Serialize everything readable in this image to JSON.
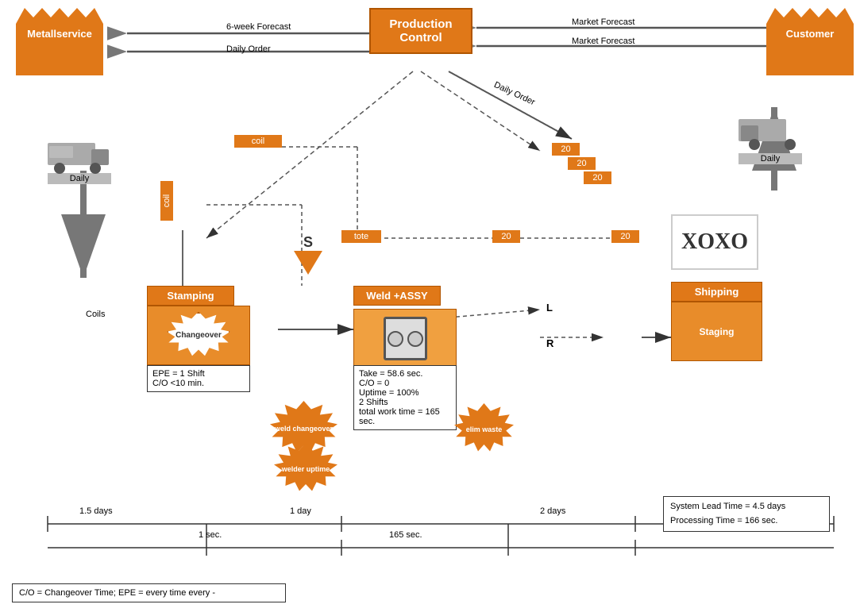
{
  "header": {
    "production_control_label": "Production Control",
    "customer_label": "Customer",
    "metallservice_label": "Metallservice"
  },
  "flows": {
    "week_forecast": "6-week Forecast",
    "daily_order_left": "Daily Order",
    "market_forecast_top": "Market Forecast",
    "market_forecast_bottom": "Market Forecast",
    "daily_order_right": "Daily Order"
  },
  "inventory": {
    "coil_top": "coil",
    "coil_left": "coil",
    "tote": "tote",
    "qty_20_1": "20",
    "qty_20_2": "20",
    "qty_20_3": "20",
    "qty_20_mid": "20",
    "qty_20_ship": "20"
  },
  "processes": {
    "stamping": "Stamping",
    "weld_assy": "Weld +ASSY",
    "shipping": "Shipping",
    "changeover": "Changeover",
    "staging": "Staging"
  },
  "data_boxes": {
    "stamping": {
      "epe": "EPE = 1 Shift",
      "co": "C/O <10 min."
    },
    "weld": {
      "take": "Take = 58.6 sec.",
      "co": "C/O = 0",
      "uptime": "Uptime = 100%",
      "shifts": "2 Shifts",
      "total_work": "total work time = 165 sec."
    }
  },
  "kaizen": {
    "weld_changeover": "weld changeover",
    "welder_uptime": "welder uptime",
    "elim_waste": "elim waste"
  },
  "labels": {
    "coils": "Coils",
    "daily_left": "Daily",
    "daily_right": "Daily",
    "push_symbol": "S",
    "L": "L",
    "R": "R"
  },
  "timeline": {
    "days_1_5": "1.5 days",
    "days_1": "1 day",
    "days_2": "2 days",
    "sec_1": "1 sec.",
    "sec_165": "165 sec."
  },
  "summary": {
    "lead_time": "System Lead Time = 4.5 days",
    "processing_time": "Processing Time = 166 sec."
  },
  "legend": {
    "text": "C/O = Changeover Time; EPE = every time every -"
  },
  "xoxo": "XOXO"
}
